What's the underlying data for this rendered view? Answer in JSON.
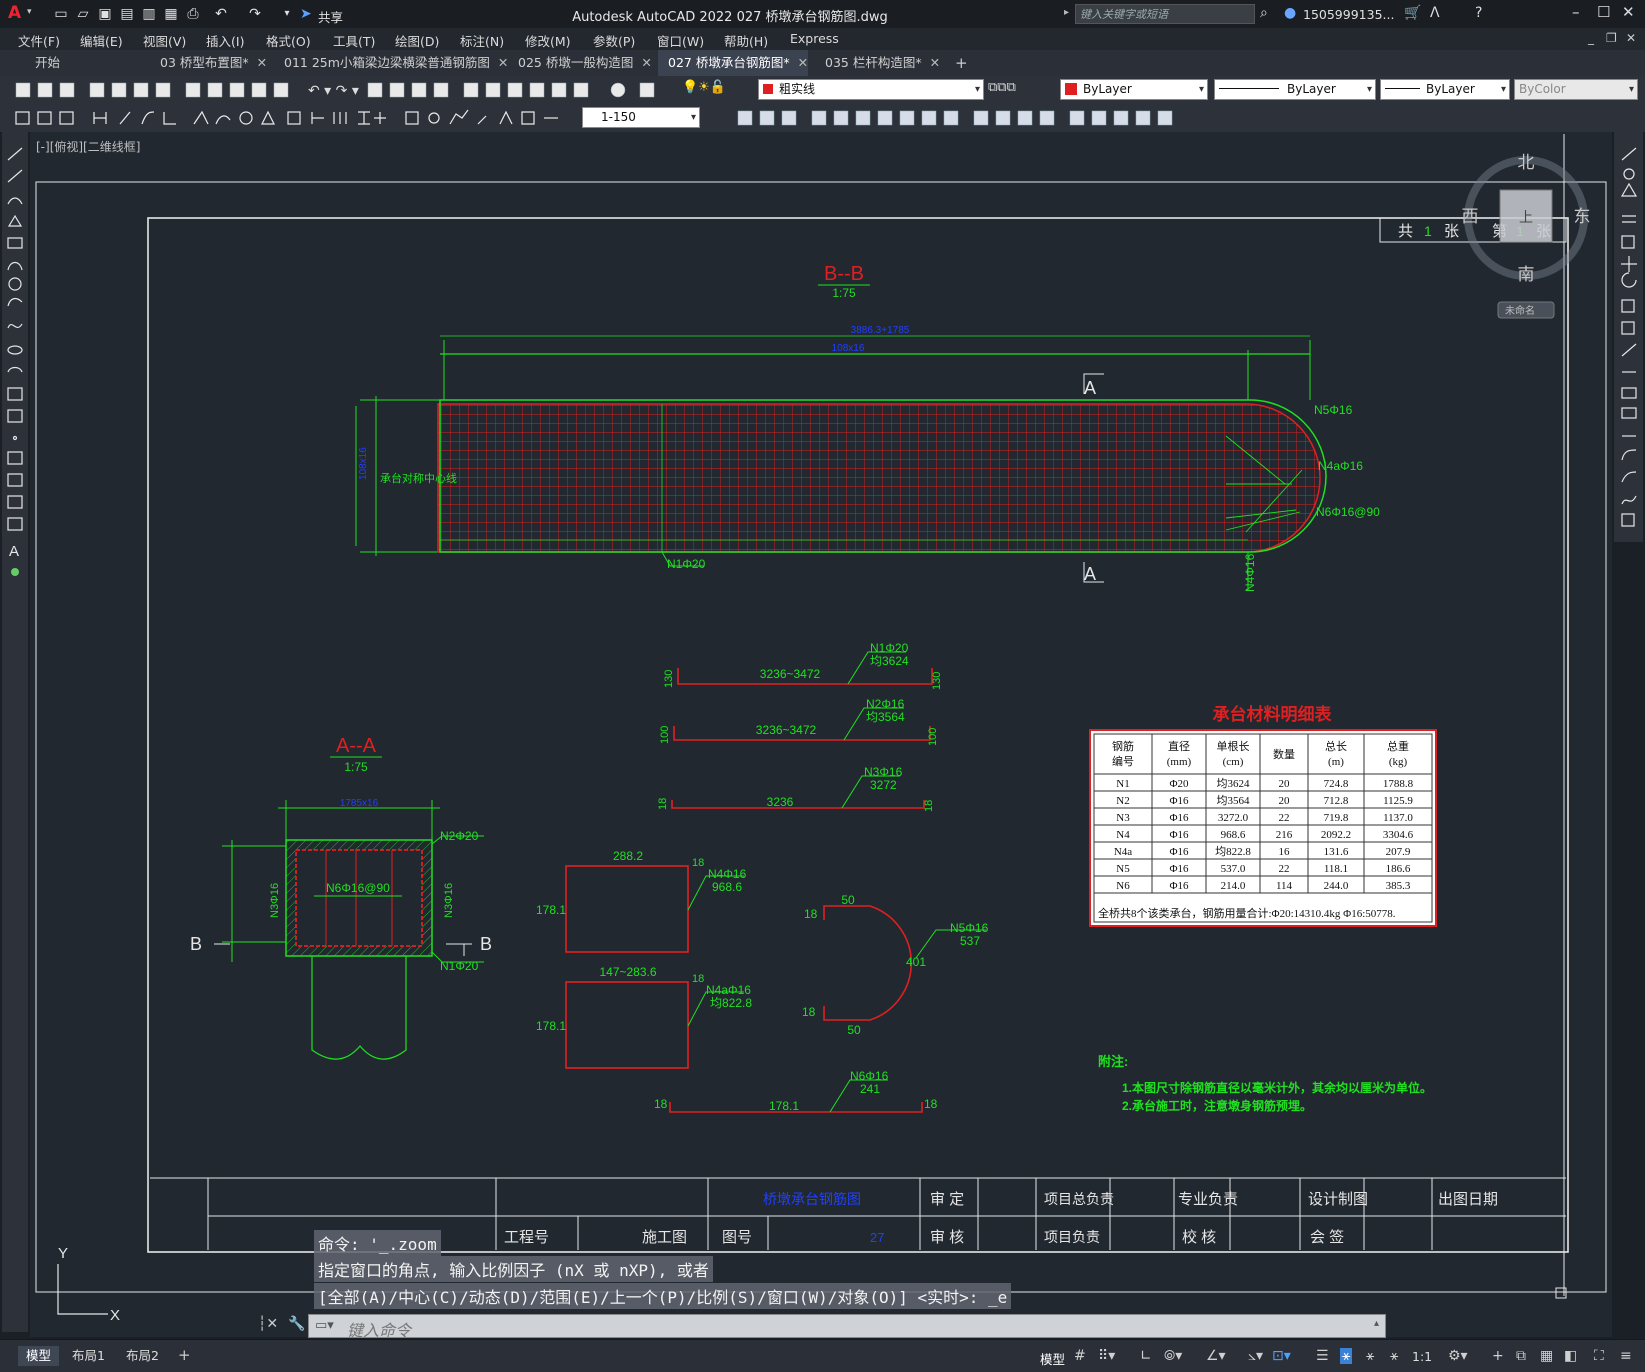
{
  "app": {
    "title": "Autodesk AutoCAD 2022    027 桥墩承台钢筋图.dwg",
    "share_label": "共享",
    "search_placeholder": "键入关键字或短语",
    "user": "1505999135...",
    "logo": "A"
  },
  "menu": [
    "文件(F)",
    "编辑(E)",
    "视图(V)",
    "插入(I)",
    "格式(O)",
    "工具(T)",
    "绘图(D)",
    "标注(N)",
    "修改(M)",
    "参数(P)",
    "窗口(W)",
    "帮助(H)",
    "Express"
  ],
  "file_tabs": [
    {
      "label": "开始",
      "close": false,
      "active": false
    },
    {
      "label": "03  桥型布置图*",
      "close": true,
      "active": false
    },
    {
      "label": "011 25m小箱梁边梁横梁普通钢筋图",
      "close": true,
      "active": false
    },
    {
      "label": "025 桥墩一般构造图",
      "close": true,
      "active": false
    },
    {
      "label": "027 桥墩承台钢筋图*",
      "close": true,
      "active": true
    },
    {
      "label": "035 栏杆构造图*",
      "close": true,
      "active": false
    }
  ],
  "toolbar": {
    "layer_value": "粗实线",
    "color_value": "ByLayer",
    "linetype_value": "ByLayer",
    "lineweight_value": "ByLayer",
    "plotstyle_value": "ByColor",
    "scale_value": "1-150"
  },
  "viewport_label": "[-][俯视][二维线框]",
  "viewcube": {
    "north": "北",
    "south": "南",
    "east": "东",
    "west": "西",
    "top": "上",
    "wcs": "未命名"
  },
  "drawing": {
    "sheet_counter": {
      "gong": "共",
      "total": "1",
      "zhang1": "张",
      "di": "第",
      "current": "1",
      "zhang2": "张"
    },
    "section_bb": {
      "title": "B--B",
      "scale": "1:75"
    },
    "section_aa": {
      "title": "A--A",
      "scale": "1:75"
    },
    "section_marks": {
      "a": "A",
      "b": "B"
    },
    "plan_labels": {
      "n5": "N5Φ16",
      "n4a": "N4aΦ16",
      "n6": "N6Φ16@90",
      "n1": "N1Φ20",
      "n4": "N4Φ16",
      "center": "承台对称中心线",
      "dim_top": "3886.3+1785",
      "dim_top2": "108x16"
    },
    "aa_labels": {
      "n2": "N2Φ20",
      "n6": "N6Φ16@90",
      "n3l": "N3Φ16",
      "n3r": "N3Φ16",
      "n1": "N1Φ20",
      "dim": "1785x16"
    },
    "rebars": {
      "n1": {
        "label": "N1Φ20",
        "sub": "均3624",
        "len": "3236~3472",
        "end": "130"
      },
      "n2": {
        "label": "N2Φ16",
        "sub": "均3564",
        "len": "3236~3472",
        "end": "100"
      },
      "n3": {
        "label": "N3Φ16",
        "sub": "3272",
        "len": "3236",
        "end": "18"
      },
      "n4": {
        "label": "N4Φ16",
        "sub": "968.6",
        "w": "288.2",
        "h": "178.1",
        "end": "18"
      },
      "n4a": {
        "label": "N4aΦ16",
        "sub": "均822.8",
        "w": "147~283.6",
        "h": "178.1",
        "end": "18"
      },
      "n5": {
        "label": "N5Φ16",
        "sub": "537",
        "r": "401",
        "leg": "50",
        "end": "18"
      },
      "n6": {
        "label": "N6Φ16",
        "sub": "241",
        "len": "178.1",
        "end": "18"
      }
    },
    "table": {
      "title": "承台材料明细表",
      "headers": [
        [
          "钢筋",
          "编号"
        ],
        [
          "直径",
          "(mm)"
        ],
        [
          "单根长",
          "(cm)"
        ],
        [
          "数量"
        ],
        [
          "总长",
          "(m)"
        ],
        [
          "总重",
          "(kg)"
        ]
      ],
      "rows": [
        [
          "N1",
          "Φ20",
          "均3624",
          "20",
          "724.8",
          "1788.8"
        ],
        [
          "N2",
          "Φ16",
          "均3564",
          "20",
          "712.8",
          "1125.9"
        ],
        [
          "N3",
          "Φ16",
          "3272.0",
          "22",
          "719.8",
          "1137.0"
        ],
        [
          "N4",
          "Φ16",
          "968.6",
          "216",
          "2092.2",
          "3304.6"
        ],
        [
          "N4a",
          "Φ16",
          "均822.8",
          "16",
          "131.6",
          "207.9"
        ],
        [
          "N5",
          "Φ16",
          "537.0",
          "22",
          "118.1",
          "186.6"
        ],
        [
          "N6",
          "Φ16",
          "214.0",
          "114",
          "244.0",
          "385.3"
        ]
      ],
      "footer": "全桥共8个该类承台，钢筋用量合计:Φ20:14310.4kg    Φ16:50778."
    },
    "notes": {
      "title": "附注:",
      "lines": [
        "1.本图尺寸除钢筋直径以毫米计外，其余均以厘米为单位。",
        "2.承台施工时，注意墩身钢筋预埋。"
      ]
    },
    "title_block": {
      "drawing_name": "桥墩承台钢筋图",
      "project_no": "工程号",
      "stage": "施工图",
      "drawing_no_label": "图号",
      "drawing_no": "27",
      "shending": "审 定",
      "shenhe": "审 核",
      "pm1": "项目总负责",
      "pm2": "项目负责",
      "zy": "专业负责",
      "jh": "校 核",
      "design": "设计制图",
      "hq": "会 签",
      "date": "出图日期"
    },
    "ucs": {
      "x": "X",
      "y": "Y"
    }
  },
  "command": {
    "history": [
      "命令: '_.zoom",
      "指定窗口的角点, 输入比例因子 (nX 或 nXP), 或者",
      "[全部(A)/中心(C)/动态(D)/范围(E)/上一个(P)/比例(S)/窗口(W)/对象(O)] <实时>: _e"
    ],
    "placeholder": "键入命令"
  },
  "status": {
    "layout_tabs": [
      "模型",
      "布局1",
      "布局2"
    ],
    "model_label": "模型",
    "scale": "1:1"
  },
  "colors": {
    "drawing_bg": "#212830",
    "green": "#20e020",
    "red": "#e02020",
    "blue": "#2040ff",
    "white": "#d8d8d8"
  }
}
